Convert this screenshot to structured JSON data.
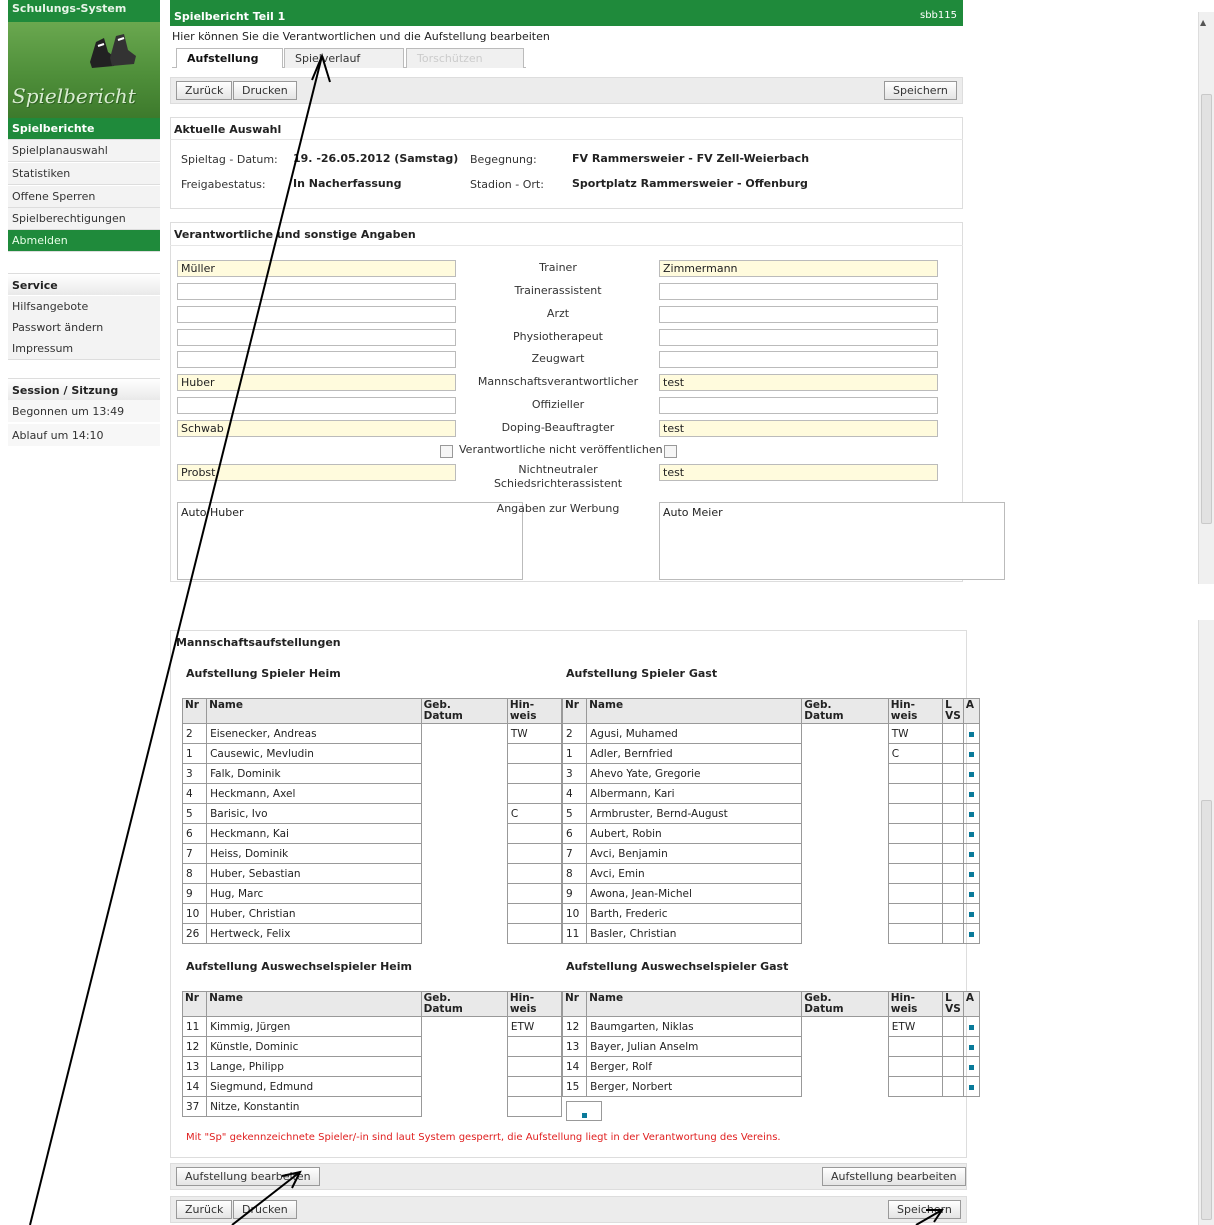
{
  "app": {
    "brand": "Schulungs-System",
    "logo_text": "Spielbericht",
    "page_title": "Spielbericht Teil 1",
    "page_code": "sbb115",
    "intro": "Hier können Sie die Verantwortlichen und die Aufstellung bearbeiten"
  },
  "sidebar": {
    "section_title": "Spielberichte",
    "items": [
      "Spielplanauswahl",
      "Statistiken",
      "Offene Sperren",
      "Spielberechtigungen",
      "Abmelden"
    ],
    "service_title": "Service",
    "service_items": [
      "Hilfsangebote",
      "Passwort ändern",
      "Impressum"
    ],
    "session_title": "Session / Sitzung",
    "session_start": "Begonnen um 13:49",
    "session_end": "Ablauf um 14:10"
  },
  "tabs": [
    {
      "label": "Aufstellung"
    },
    {
      "label": "Spielverlauf"
    },
    {
      "label": "Torschützen"
    }
  ],
  "toolbar": {
    "back": "Zurück",
    "print": "Drucken",
    "save": "Speichern",
    "edit_lineup": "Aufstellung bearbeiten"
  },
  "selection": {
    "title": "Aktuelle Auswahl",
    "matchday_label": "Spieltag - Datum:",
    "matchday_value": "19. -26.05.2012 (Samstag)",
    "match_label": "Begegnung:",
    "match_value": "FV Rammersweier - FV Zell-Weierbach",
    "release_label": "Freigabestatus:",
    "release_value": "In Nacherfassung",
    "stadium_label": "Stadion - Ort:",
    "stadium_value": "Sportplatz Rammersweier - Offenburg"
  },
  "officials": {
    "title": "Verantwortliche und sonstige Angaben",
    "rows": [
      {
        "label": "Trainer",
        "home": "Müller",
        "away": "Zimmermann",
        "hy": true,
        "ay": true
      },
      {
        "label": "Trainerassistent",
        "home": "",
        "away": "",
        "hy": false,
        "ay": false
      },
      {
        "label": "Arzt",
        "home": "",
        "away": "",
        "hy": false,
        "ay": false
      },
      {
        "label": "Physiotherapeut",
        "home": "",
        "away": "",
        "hy": false,
        "ay": false
      },
      {
        "label": "Zeugwart",
        "home": "",
        "away": "",
        "hy": false,
        "ay": false
      },
      {
        "label": "Mannschaftsverantwortlicher",
        "home": "Huber",
        "away": "test",
        "hy": true,
        "ay": true
      },
      {
        "label": "Offizieller",
        "home": "",
        "away": "",
        "hy": false,
        "ay": false
      },
      {
        "label": "Doping-Beauftragter",
        "home": "Schwab",
        "away": "test",
        "hy": true,
        "ay": true
      }
    ],
    "hide_label": "Verantwortliche nicht veröffentlichen",
    "neutral_label_1": "Nichtneutraler",
    "neutral_label_2": "Schiedsrichterassistent",
    "neutral_home": "Probst",
    "neutral_away": "test",
    "ads_label": "Angaben zur Werbung",
    "ads_home": "Auto Huber",
    "ads_away": "Auto Meier"
  },
  "lineups": {
    "title": "Mannschaftsaufstellungen",
    "home_title": "Aufstellung Spieler Heim",
    "away_title": "Aufstellung Spieler Gast",
    "home_sub_title": "Aufstellung Auswechselspieler Heim",
    "away_sub_title": "Aufstellung Auswechselspieler Gast",
    "col_nr": "Nr",
    "col_name": "Name",
    "col_dob_1": "Geb.",
    "col_dob_2": "Datum",
    "col_hint_1": "Hin-",
    "col_hint_2": "weis",
    "col_l_1": "L",
    "col_l_2": "VS",
    "col_a": "A",
    "home": [
      [
        "2",
        "Eisenecker, Andreas",
        "TW"
      ],
      [
        "1",
        "Causewic, Mevludin",
        ""
      ],
      [
        "3",
        "Falk, Dominik",
        ""
      ],
      [
        "4",
        "Heckmann, Axel",
        ""
      ],
      [
        "5",
        "Barisic, Ivo",
        "C"
      ],
      [
        "6",
        "Heckmann, Kai",
        ""
      ],
      [
        "7",
        "Heiss, Dominik",
        ""
      ],
      [
        "8",
        "Huber, Sebastian",
        ""
      ],
      [
        "9",
        "Hug, Marc",
        ""
      ],
      [
        "10",
        "Huber, Christian",
        ""
      ],
      [
        "26",
        "Hertweck, Felix",
        ""
      ]
    ],
    "away": [
      [
        "2",
        "Agusi, Muhamed",
        "TW"
      ],
      [
        "1",
        "Adler, Bernfried",
        "C"
      ],
      [
        "3",
        "Ahevo Yate, Gregorie",
        ""
      ],
      [
        "4",
        "Albermann, Kari",
        ""
      ],
      [
        "5",
        "Armbruster, Bernd-August",
        ""
      ],
      [
        "6",
        "Aubert, Robin",
        ""
      ],
      [
        "7",
        "Avci, Benjamin",
        ""
      ],
      [
        "8",
        "Avci, Emin",
        ""
      ],
      [
        "9",
        "Awona, Jean-Michel",
        ""
      ],
      [
        "10",
        "Barth, Frederic",
        ""
      ],
      [
        "11",
        "Basler, Christian",
        ""
      ]
    ],
    "home_subs": [
      [
        "11",
        "Kimmig, Jürgen",
        "ETW"
      ],
      [
        "12",
        "Künstle, Dominic",
        ""
      ],
      [
        "13",
        "Lange, Philipp",
        ""
      ],
      [
        "14",
        "Siegmund, Edmund",
        ""
      ],
      [
        "37",
        "Nitze, Konstantin",
        ""
      ]
    ],
    "away_subs": [
      [
        "12",
        "Baumgarten, Niklas",
        "ETW"
      ],
      [
        "13",
        "Bayer, Julian Anselm",
        ""
      ],
      [
        "14",
        "Berger, Rolf",
        ""
      ],
      [
        "15",
        "Berger, Norbert",
        ""
      ]
    ],
    "note": "Mit \"Sp\" gekennzeichnete Spieler/-in sind laut System gesperrt, die Aufstellung liegt in der Verantwortung des Vereins."
  },
  "colors": {
    "green": "#1f8a3b",
    "highlight": "#fffbdd",
    "note": "#e02020"
  }
}
